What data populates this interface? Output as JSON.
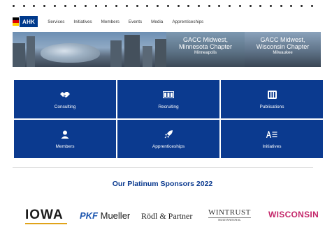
{
  "brand": {
    "logo_text": "AHK",
    "flag_colors": [
      "#000000",
      "#dd0000",
      "#ffce00"
    ]
  },
  "nav": {
    "items": [
      "Services",
      "Initiatives",
      "Members",
      "Events",
      "Media",
      "Apprenticeships"
    ]
  },
  "hero": {
    "panels": [
      {
        "title_line1": "GACC Midwest,",
        "title_line2": "Minnesota Chapter",
        "city": "Minneapolis"
      },
      {
        "title_line1": "GACC Midwest,",
        "title_line2": "Wisconsin Chapter",
        "city": "Milwaukee"
      }
    ]
  },
  "tiles": [
    {
      "label": "Consulting",
      "icon": "handshake-icon"
    },
    {
      "label": "Recruiting",
      "icon": "people-group-icon"
    },
    {
      "label": "Publications",
      "icon": "newspaper-icon"
    },
    {
      "label": "Members",
      "icon": "person-icon"
    },
    {
      "label": "Apprenticeships",
      "icon": "rocket-icon"
    },
    {
      "label": "Initiatives",
      "icon": "text-list-icon"
    }
  ],
  "sponsors": {
    "title": "Our Platinum Sponsors 2022",
    "logos": {
      "iowa": "IOWA",
      "pkf_a": "PKF",
      "pkf_b": "Mueller",
      "rodl": "Rödl & Partner",
      "wintrust": "WINTRUST",
      "wintrust_sub": "MULTINATIONAL",
      "wisconsin": "WISCONSIN"
    }
  },
  "colors": {
    "tile_blue": "#0b3a8f",
    "sponsor_title": "#0b3a8f"
  }
}
